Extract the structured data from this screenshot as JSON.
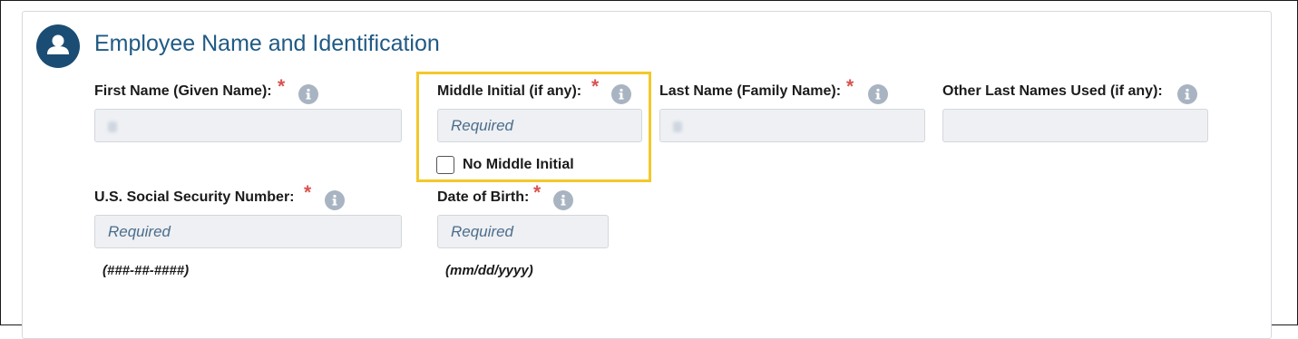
{
  "section": {
    "title": "Employee Name and Identification",
    "icon": "person-icon"
  },
  "colors": {
    "accent": "#205a84",
    "avatar_bg": "#1b4d74",
    "required_star": "#d9534f",
    "highlight": "#f3c82a",
    "info_icon": "#a9b4c2",
    "input_bg": "#eef0f3"
  },
  "fields": {
    "first_name": {
      "label": "First Name (Given Name):",
      "required_mark": "*",
      "value": "",
      "placeholder": ""
    },
    "middle_initial": {
      "label": "Middle Initial (if any):",
      "required_mark": "*",
      "value": "",
      "placeholder": "Required"
    },
    "last_name": {
      "label": "Last Name (Family Name):",
      "required_mark": "*",
      "value": "",
      "placeholder": ""
    },
    "other_last_names": {
      "label": "Other Last Names Used (if any):",
      "value": "",
      "placeholder": ""
    },
    "ssn": {
      "label": "U.S. Social Security Number:",
      "required_mark": "*",
      "placeholder": "Required",
      "hint": "(###-##-####)"
    },
    "dob": {
      "label": "Date of Birth:",
      "required_mark": "*",
      "placeholder": "Required",
      "hint": "(mm/dd/yyyy)"
    }
  },
  "no_middle_initial": {
    "label": "No Middle Initial",
    "checked": false
  }
}
